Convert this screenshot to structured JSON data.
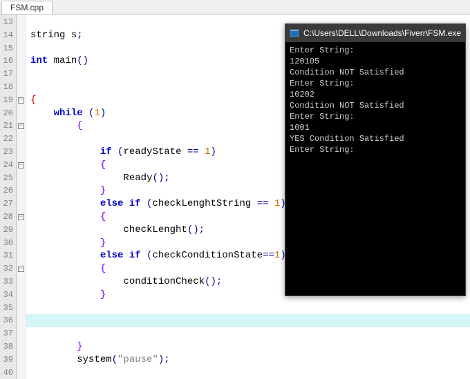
{
  "tab": {
    "label": "FSM.cpp"
  },
  "lines": [
    {
      "n": 13,
      "fold": "",
      "tokens": []
    },
    {
      "n": 14,
      "fold": "",
      "tokens": [
        [
          "id",
          "string "
        ],
        [
          "id",
          "s"
        ],
        [
          "pn",
          ";"
        ]
      ]
    },
    {
      "n": 15,
      "fold": "",
      "tokens": []
    },
    {
      "n": 16,
      "fold": "",
      "tokens": [
        [
          "kw",
          "int "
        ],
        [
          "id",
          "main"
        ],
        [
          "pn",
          "()"
        ]
      ]
    },
    {
      "n": 17,
      "fold": "",
      "tokens": []
    },
    {
      "n": 18,
      "fold": "",
      "tokens": []
    },
    {
      "n": 19,
      "fold": "-",
      "tokens": [
        [
          "brace-red",
          "{"
        ]
      ]
    },
    {
      "n": 20,
      "fold": "",
      "tokens": [
        [
          "id",
          "    "
        ],
        [
          "kw",
          "while "
        ],
        [
          "pn",
          "("
        ],
        [
          "num",
          "1"
        ],
        [
          "pn",
          ")"
        ]
      ]
    },
    {
      "n": 21,
      "fold": "-",
      "tokens": [
        [
          "id",
          "        "
        ],
        [
          "brace-pur",
          "{"
        ]
      ]
    },
    {
      "n": 22,
      "fold": "",
      "tokens": []
    },
    {
      "n": 23,
      "fold": "",
      "tokens": [
        [
          "id",
          "            "
        ],
        [
          "kw",
          "if "
        ],
        [
          "pn",
          "("
        ],
        [
          "id",
          "readyState "
        ],
        [
          "pn",
          "== "
        ],
        [
          "num",
          "1"
        ],
        [
          "pn",
          ")"
        ]
      ]
    },
    {
      "n": 24,
      "fold": "-",
      "tokens": [
        [
          "id",
          "            "
        ],
        [
          "brace-pur",
          "{"
        ]
      ]
    },
    {
      "n": 25,
      "fold": "",
      "tokens": [
        [
          "id",
          "                Ready"
        ],
        [
          "pn",
          "();"
        ]
      ]
    },
    {
      "n": 26,
      "fold": "",
      "tokens": [
        [
          "id",
          "            "
        ],
        [
          "brace-pur",
          "}"
        ]
      ]
    },
    {
      "n": 27,
      "fold": "",
      "tokens": [
        [
          "id",
          "            "
        ],
        [
          "kw",
          "else if "
        ],
        [
          "pn",
          "("
        ],
        [
          "id",
          "checkLenghtString "
        ],
        [
          "pn",
          "== "
        ],
        [
          "num",
          "1"
        ],
        [
          "pn",
          ")"
        ]
      ]
    },
    {
      "n": 28,
      "fold": "-",
      "tokens": [
        [
          "id",
          "            "
        ],
        [
          "brace-pur",
          "{"
        ]
      ]
    },
    {
      "n": 29,
      "fold": "",
      "tokens": [
        [
          "id",
          "                checkLenght"
        ],
        [
          "pn",
          "();"
        ]
      ]
    },
    {
      "n": 30,
      "fold": "",
      "tokens": [
        [
          "id",
          "            "
        ],
        [
          "brace-pur",
          "}"
        ]
      ]
    },
    {
      "n": 31,
      "fold": "",
      "tokens": [
        [
          "id",
          "            "
        ],
        [
          "kw",
          "else if "
        ],
        [
          "pn",
          "("
        ],
        [
          "id",
          "checkConditionState"
        ],
        [
          "pn",
          "=="
        ],
        [
          "num",
          "1"
        ],
        [
          "pn",
          ")"
        ]
      ]
    },
    {
      "n": 32,
      "fold": "-",
      "tokens": [
        [
          "id",
          "            "
        ],
        [
          "brace-pur",
          "{"
        ]
      ]
    },
    {
      "n": 33,
      "fold": "",
      "tokens": [
        [
          "id",
          "                conditionCheck"
        ],
        [
          "pn",
          "();"
        ]
      ]
    },
    {
      "n": 34,
      "fold": "",
      "tokens": [
        [
          "id",
          "            "
        ],
        [
          "brace-pur",
          "}"
        ]
      ]
    },
    {
      "n": 35,
      "fold": "",
      "tokens": []
    },
    {
      "n": 36,
      "fold": "",
      "hl": true,
      "tokens": []
    },
    {
      "n": 37,
      "fold": "",
      "tokens": []
    },
    {
      "n": 38,
      "fold": "",
      "tokens": [
        [
          "id",
          "        "
        ],
        [
          "brace-pur",
          "}"
        ]
      ]
    },
    {
      "n": 39,
      "fold": "",
      "tokens": [
        [
          "id",
          "        system"
        ],
        [
          "pn",
          "("
        ],
        [
          "str",
          "\"pause\""
        ],
        [
          "pn",
          ");"
        ]
      ]
    },
    {
      "n": 40,
      "fold": "",
      "tokens": []
    }
  ],
  "console": {
    "title": "C:\\Users\\DELL\\Downloads\\Fiverr\\FSM.exe",
    "lines": [
      "Enter String:",
      "120105",
      "Condition NOT Satisfied",
      "Enter String:",
      "10202",
      "Condition NOT Satisfied",
      "Enter String:",
      "1001",
      "YES Condition Satisfied",
      "Enter String:"
    ]
  }
}
